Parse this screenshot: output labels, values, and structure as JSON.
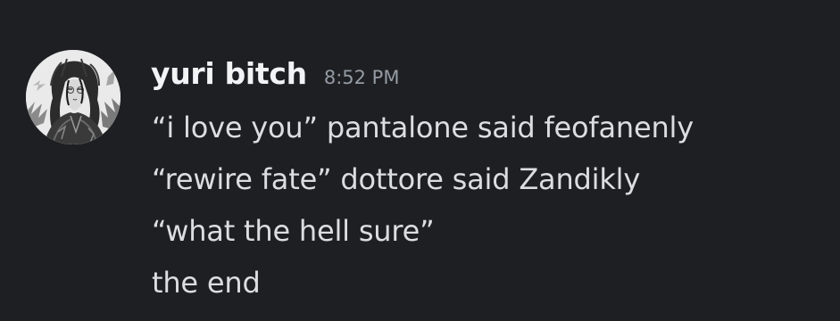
{
  "message": {
    "author": {
      "username": "yuri bitch",
      "avatar_icon": "user-avatar"
    },
    "timestamp": "8:52 PM",
    "lines": [
      "“i love you” pantalone said feofanenly",
      "“rewire fate” dottore said Zandikly",
      "“what the hell sure”",
      "the end"
    ]
  },
  "colors": {
    "background": "#1e1f22",
    "username": "#f2f3f5",
    "timestamp": "#949ba4",
    "text": "#dbdee1"
  }
}
